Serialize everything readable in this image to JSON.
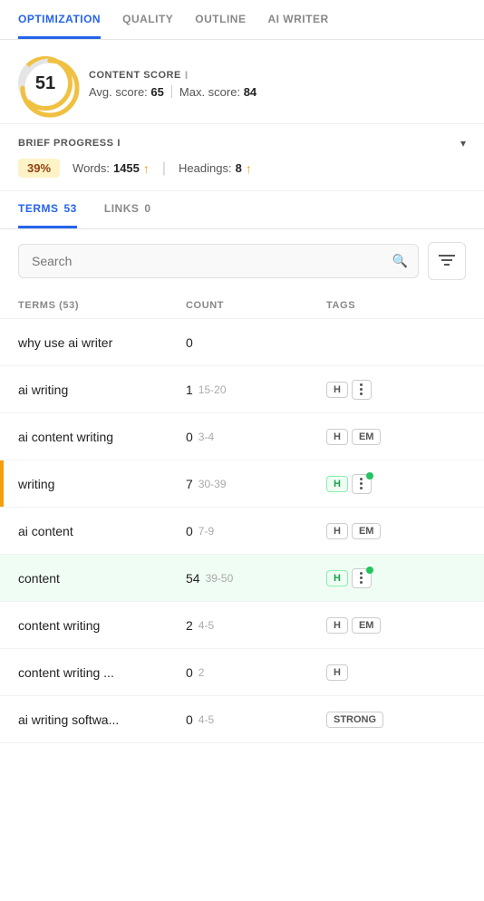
{
  "nav": {
    "tabs": [
      {
        "label": "OPTIMIZATION",
        "active": true
      },
      {
        "label": "QUALITY",
        "active": false
      },
      {
        "label": "OUTLINE",
        "active": false
      },
      {
        "label": "AI WRITER",
        "active": false
      }
    ]
  },
  "content_score": {
    "section_label": "CONTENT SCORE",
    "info": "i",
    "score": "51",
    "avg_label": "Avg. score:",
    "avg_value": "65",
    "max_label": "Max. score:",
    "max_value": "84"
  },
  "brief_progress": {
    "label": "BRIEF PROGRESS",
    "info": "i",
    "percentage": "39%",
    "words_label": "Words:",
    "words_value": "1455",
    "headings_label": "Headings:",
    "headings_value": "8"
  },
  "sub_tabs": {
    "terms": {
      "label": "TERMS",
      "count": "53",
      "active": true
    },
    "links": {
      "label": "LINKS",
      "count": "0",
      "active": false
    }
  },
  "search": {
    "placeholder": "Search",
    "filter_icon": "≡"
  },
  "table": {
    "headers": {
      "terms": "TERMS (53)",
      "count": "COUNT",
      "tags": "TAGS"
    },
    "rows": [
      {
        "term": "why use ai writer",
        "count": "0",
        "range": "",
        "tags": [],
        "highlight": ""
      },
      {
        "term": "ai writing",
        "count": "1",
        "range": "15-20",
        "tags": [
          "H",
          "dots"
        ],
        "highlight": ""
      },
      {
        "term": "ai content writing",
        "count": "0",
        "range": "3-4",
        "tags": [
          "H",
          "EM"
        ],
        "highlight": ""
      },
      {
        "term": "writing",
        "count": "7",
        "range": "30-39",
        "tags": [
          "H_green",
          "dots_green"
        ],
        "highlight": "yellow"
      },
      {
        "term": "ai content",
        "count": "0",
        "range": "7-9",
        "tags": [
          "H",
          "EM"
        ],
        "highlight": ""
      },
      {
        "term": "content",
        "count": "54",
        "range": "39-50",
        "tags": [
          "H_green",
          "dots_green"
        ],
        "highlight": "green"
      },
      {
        "term": "content writing",
        "count": "2",
        "range": "4-5",
        "tags": [
          "H",
          "EM"
        ],
        "highlight": ""
      },
      {
        "term": "content writing ...",
        "count": "0",
        "range": "2",
        "tags": [
          "H"
        ],
        "highlight": ""
      },
      {
        "term": "ai writing softwa...",
        "count": "0",
        "range": "4-5",
        "tags": [
          "STRONG"
        ],
        "highlight": ""
      }
    ]
  },
  "colors": {
    "accent_blue": "#2563eb",
    "accent_yellow": "#f59e0b",
    "accent_green": "#22c55e"
  }
}
